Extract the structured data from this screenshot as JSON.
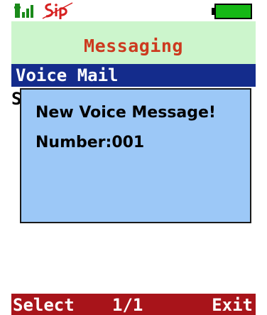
{
  "status_bar": {
    "signal_icon": "signal-strength-icon",
    "sip_icon": "sip-icon",
    "sip_text": "Sip",
    "battery_icon": "battery-icon",
    "colors": {
      "signal": "#1a8a1a",
      "sip": "#d62020",
      "battery": "#16b816"
    }
  },
  "header": {
    "title": "Messaging"
  },
  "list": {
    "items": [
      {
        "label": "Voice Mail",
        "selected": true
      },
      {
        "label": "S",
        "selected": false
      }
    ]
  },
  "dialog": {
    "line1": "New Voice Message!",
    "line2": "Number:001"
  },
  "softkeys": {
    "left": "Select",
    "center": "1/1",
    "right": "Exit"
  },
  "colors": {
    "title_bg": "#ccf5cc",
    "title_text": "#cc3a1f",
    "selection_bg": "#142c8c",
    "dialog_bg": "#9cc8f7",
    "softkey_bg": "#a8141a"
  }
}
